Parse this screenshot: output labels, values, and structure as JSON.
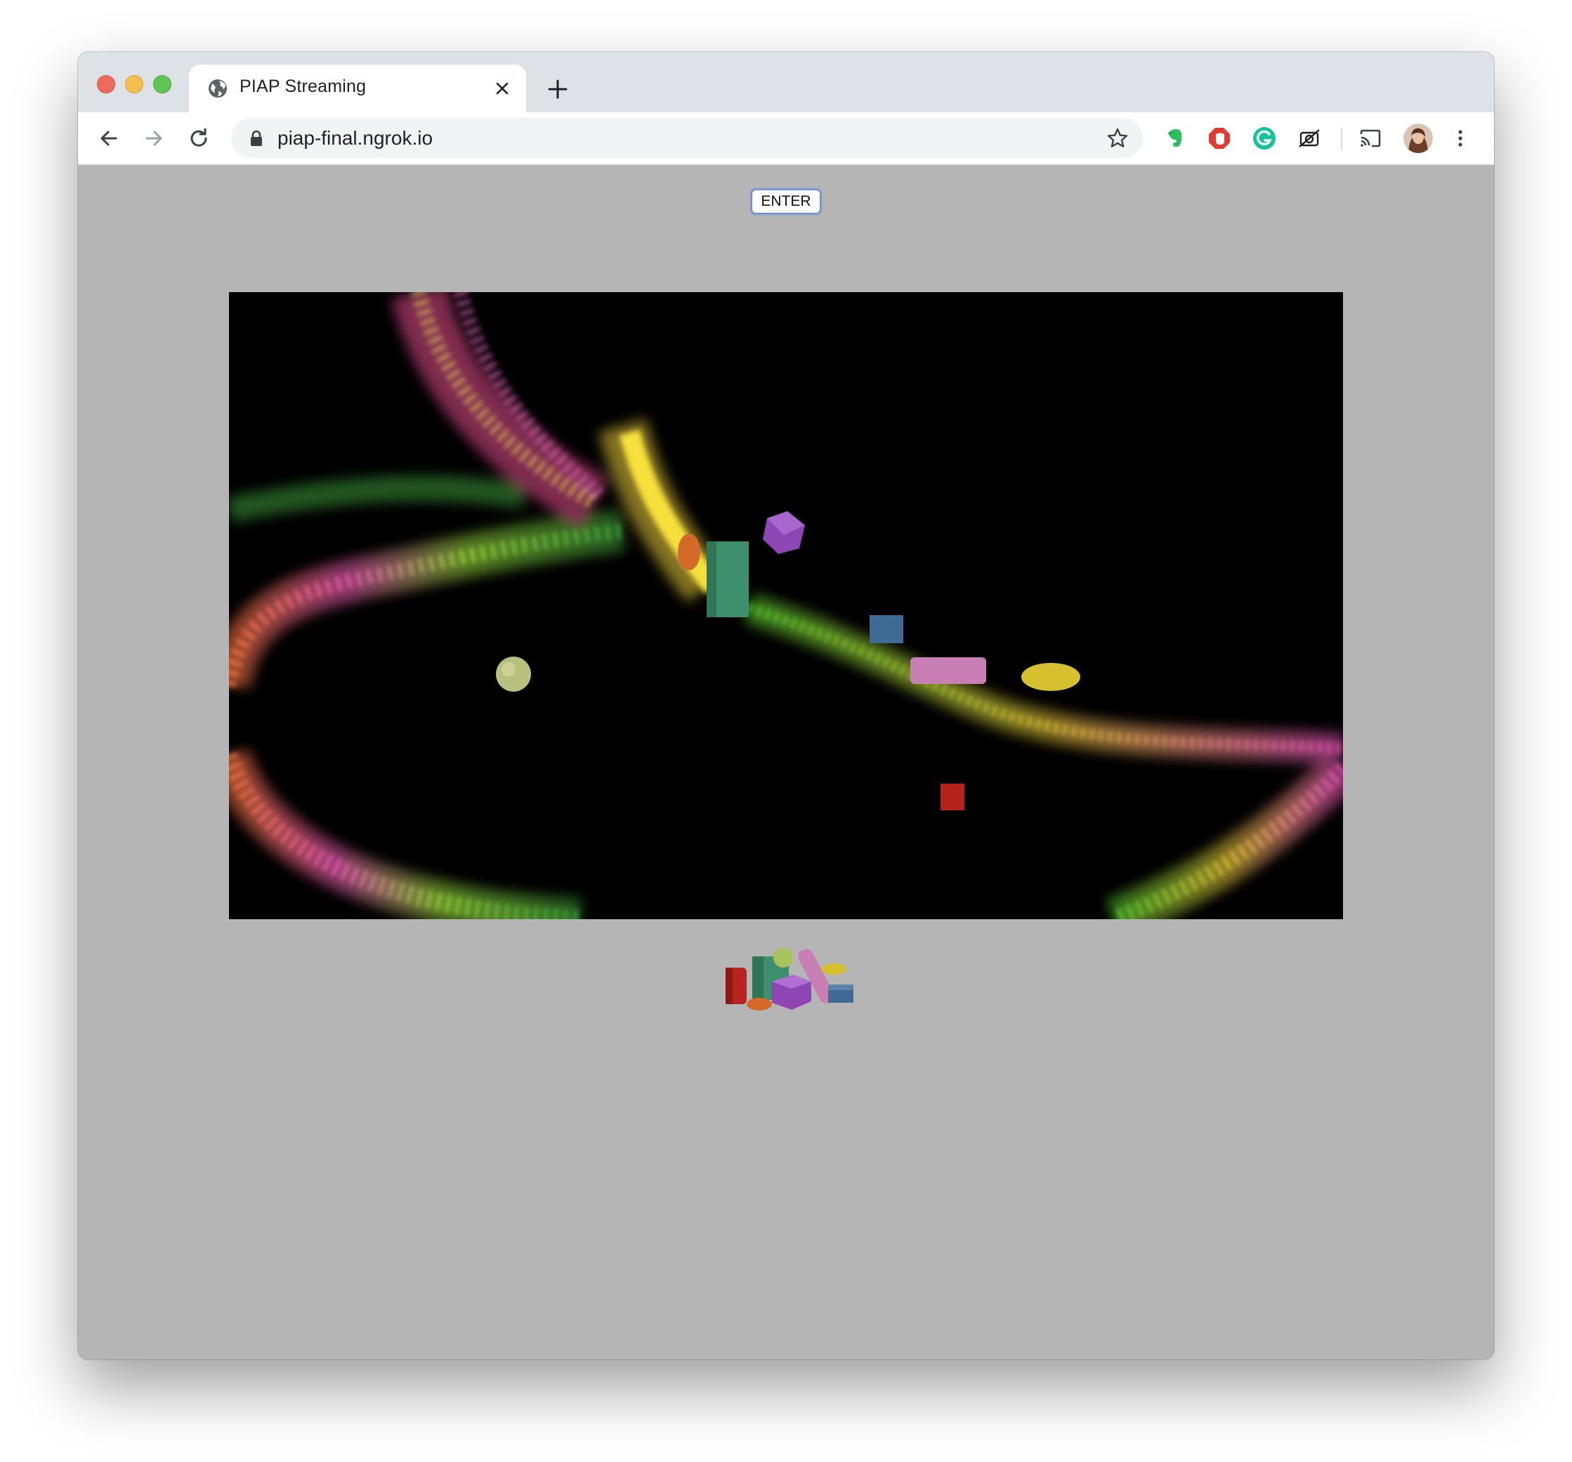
{
  "browser": {
    "tab": {
      "title": "PIAP Streaming",
      "icon": "globe-icon"
    },
    "address_bar": {
      "url": "piap-final.ngrok.io",
      "secure_icon": "lock-icon"
    },
    "nav_icons": [
      "back-arrow-icon",
      "forward-arrow-icon",
      "reload-icon"
    ],
    "extensions": [
      "evernote-icon",
      "adblock-icon",
      "grammarly-icon",
      "camera-extension-icon"
    ],
    "toolbar_icons": [
      "bookmark-star-icon",
      "cast-icon",
      "profile-avatar",
      "more-menu-icon"
    ]
  },
  "page": {
    "enter_button": "ENTER",
    "stream": {
      "description_icon": "video-stream"
    },
    "colors": {
      "page_background": "#b5b5b5",
      "stream_background": "#000000",
      "button_border": "#6b8fd9"
    }
  }
}
